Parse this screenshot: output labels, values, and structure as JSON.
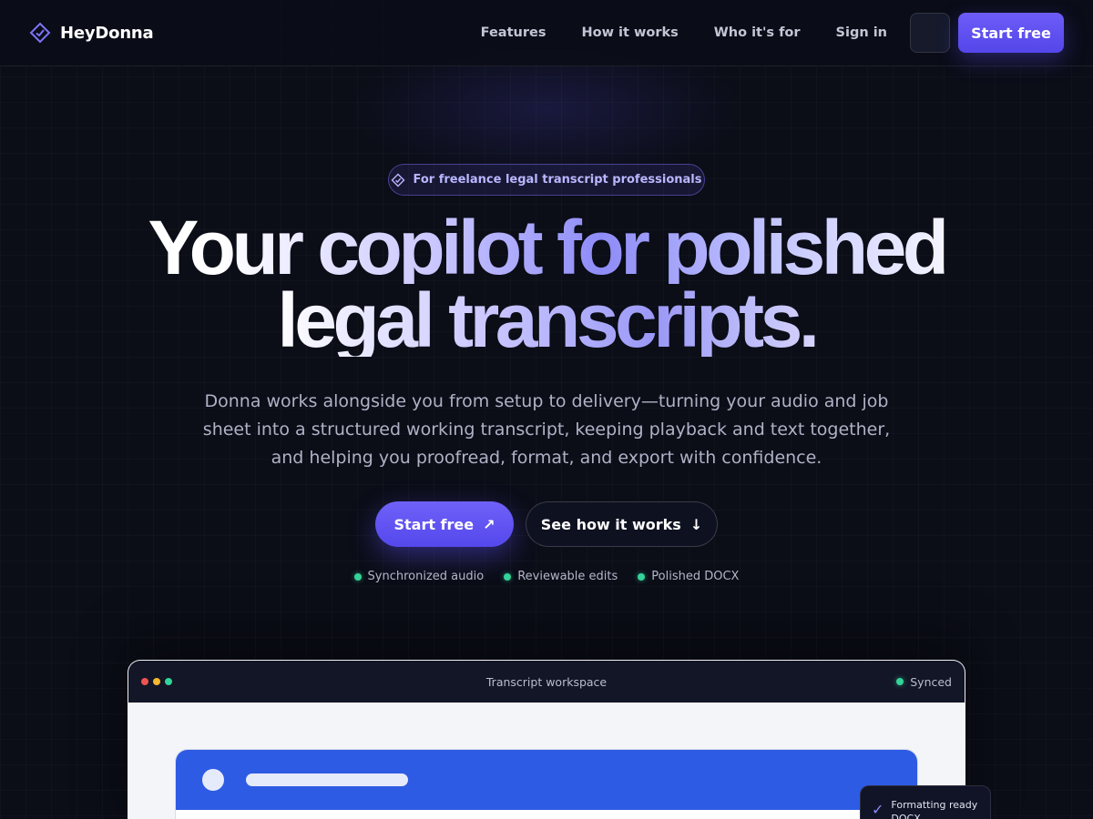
{
  "nav": {
    "brand": "HeyDonna",
    "links": [
      "Features",
      "How it works",
      "Who it's for",
      "Sign in"
    ],
    "cta": "Start free",
    "brand_icon": "diamond-logo-icon",
    "accent": "#5c4ef0"
  },
  "hero": {
    "pill": "For freelance legal transcript professionals",
    "headline_line1": "Your copilot for polished",
    "headline_line2": "legal transcripts.",
    "subtitle": "Donna works alongside you from setup to delivery—turning your audio and job sheet into a structured working transcript, keeping playback and text together, and helping you proofread, format, and export with confidence.",
    "primary_cta": "Start free",
    "primary_cta_icon": "↗",
    "secondary_cta": "See how it works",
    "secondary_cta_icon": "↓",
    "features": [
      "Synchronized audio",
      "Reviewable edits",
      "Polished DOCX"
    ],
    "feature_dot_color": "#34d399"
  },
  "workspace": {
    "title": "Transcript workspace",
    "status": "Synced",
    "traffic_lights": [
      "#ef5350",
      "#f5b82e",
      "#34d399"
    ],
    "doc_header_color": "#2d5be3"
  },
  "toast": {
    "icon": "check-icon",
    "text": "Formatting ready DOCX"
  }
}
